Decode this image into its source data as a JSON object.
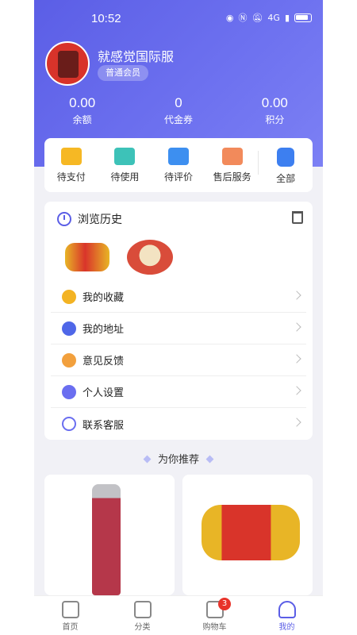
{
  "statusbar": {
    "time": "10:52",
    "signal": "4G"
  },
  "profile": {
    "name": "就感觉国际服",
    "member_level": "普通会员"
  },
  "stats": [
    {
      "value": "0.00",
      "label": "余额"
    },
    {
      "value": "0",
      "label": "代金券"
    },
    {
      "value": "0.00",
      "label": "积分"
    }
  ],
  "orders": [
    {
      "label": "待支付",
      "icon": "wallet-icon"
    },
    {
      "label": "待使用",
      "icon": "ticket-icon"
    },
    {
      "label": "待评价",
      "icon": "comment-icon"
    },
    {
      "label": "售后服务",
      "icon": "aftersale-icon"
    },
    {
      "label": "全部",
      "icon": "list-icon"
    }
  ],
  "history": {
    "title": "浏览历史"
  },
  "menu": [
    {
      "label": "我的收藏",
      "icon": "star-icon"
    },
    {
      "label": "我的地址",
      "icon": "location-icon"
    },
    {
      "label": "意见反馈",
      "icon": "feedback-icon"
    },
    {
      "label": "个人设置",
      "icon": "settings-icon"
    },
    {
      "label": "联系客服",
      "icon": "headset-icon"
    }
  ],
  "recommend": {
    "title": "为你推荐"
  },
  "tabbar": [
    {
      "label": "首页",
      "icon": "home-icon"
    },
    {
      "label": "分类",
      "icon": "category-icon"
    },
    {
      "label": "购物车",
      "icon": "cart-icon",
      "badge": "3"
    },
    {
      "label": "我的",
      "icon": "user-icon",
      "active": true
    }
  ]
}
